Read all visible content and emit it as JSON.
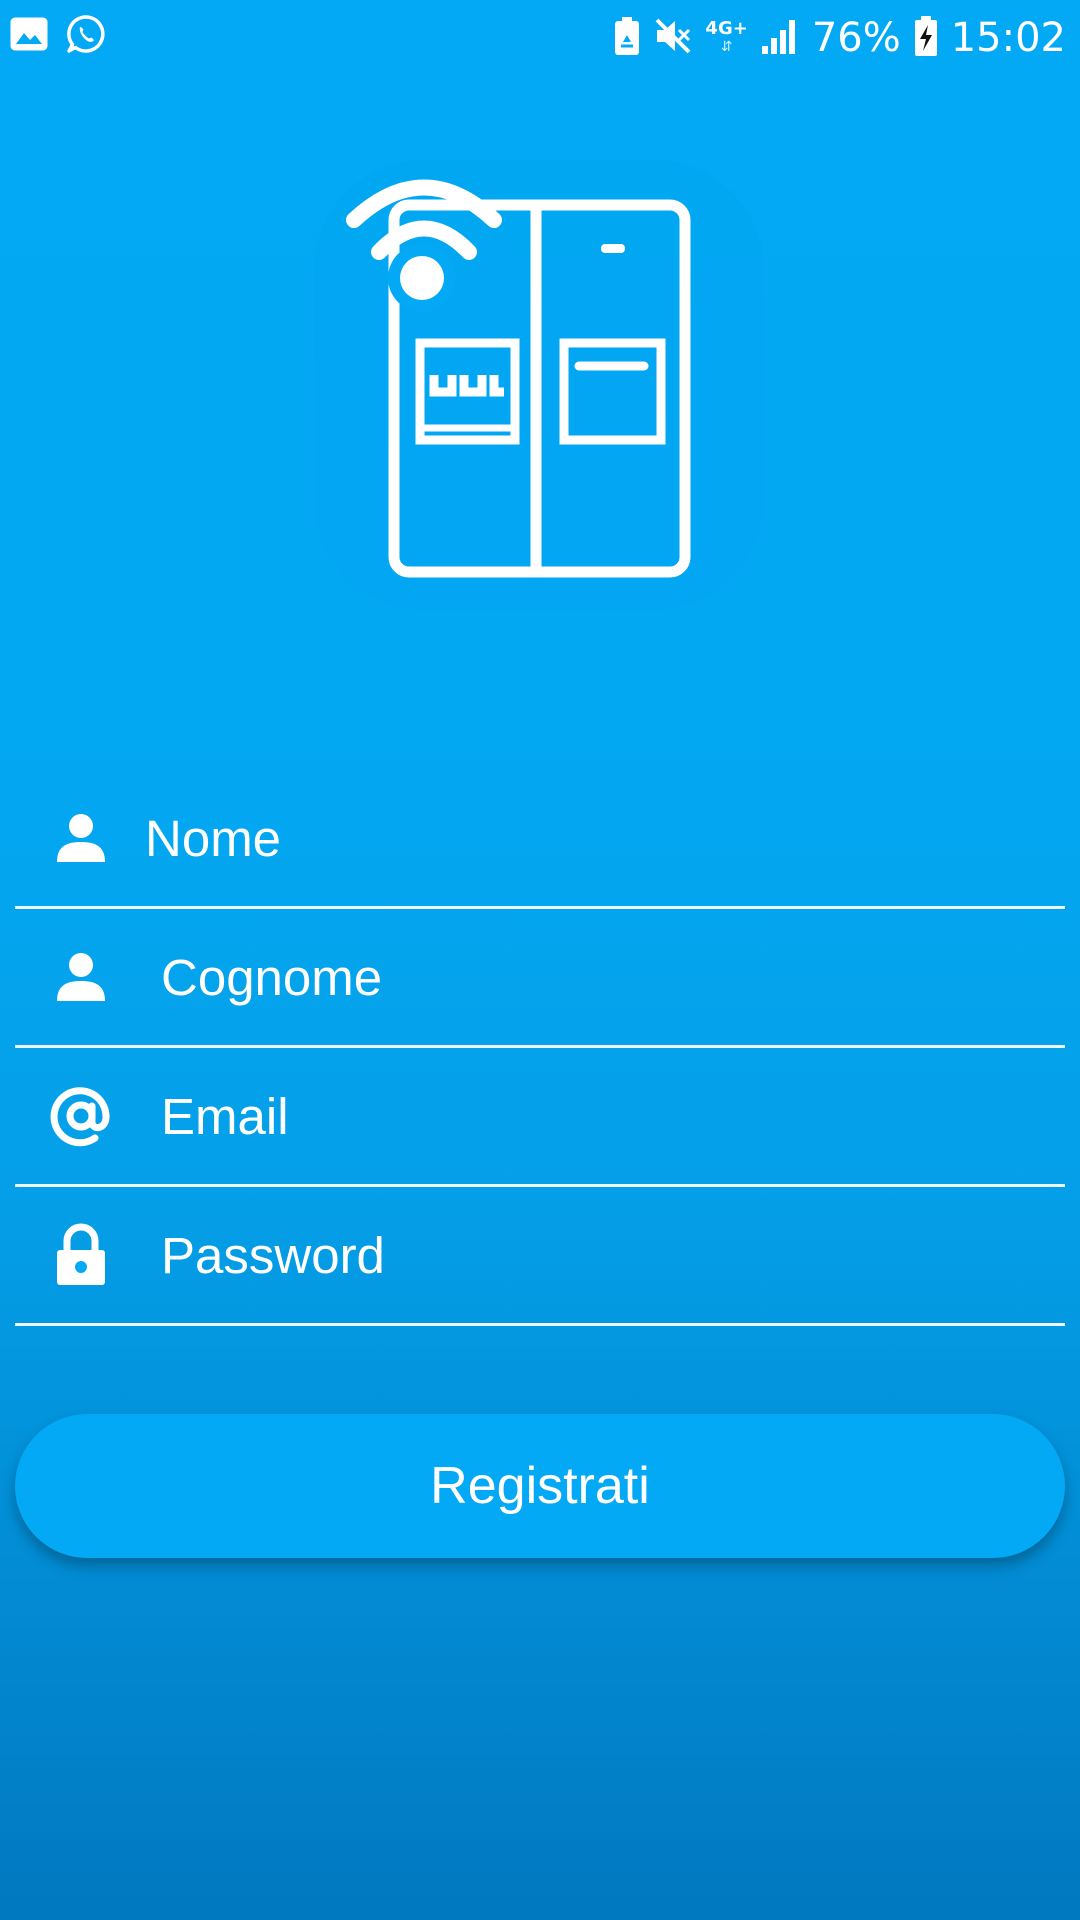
{
  "status_bar": {
    "left_icons": [
      "gallery-icon",
      "whatsapp-icon"
    ],
    "right_icons": [
      "battery-saver-icon",
      "mute-icon",
      "network-4g-icon",
      "signal-icon",
      "battery-charging-icon"
    ],
    "network": "4G+",
    "battery": "76%",
    "time": "15:02"
  },
  "logo": {
    "icon": "smart-fridge-wifi-icon"
  },
  "form": {
    "fields": [
      {
        "icon": "person-icon",
        "placeholder": "Nome"
      },
      {
        "icon": "person-icon",
        "placeholder": "Cognome"
      },
      {
        "icon": "at-sign-icon",
        "placeholder": "Email"
      },
      {
        "icon": "lock-icon",
        "placeholder": "Password"
      }
    ]
  },
  "register_button": {
    "label": "Registrati"
  },
  "colors": {
    "background_top": "#03a9f4",
    "background_bottom": "#0178c0",
    "button": "#03a9f4",
    "text": "#ffffff"
  }
}
